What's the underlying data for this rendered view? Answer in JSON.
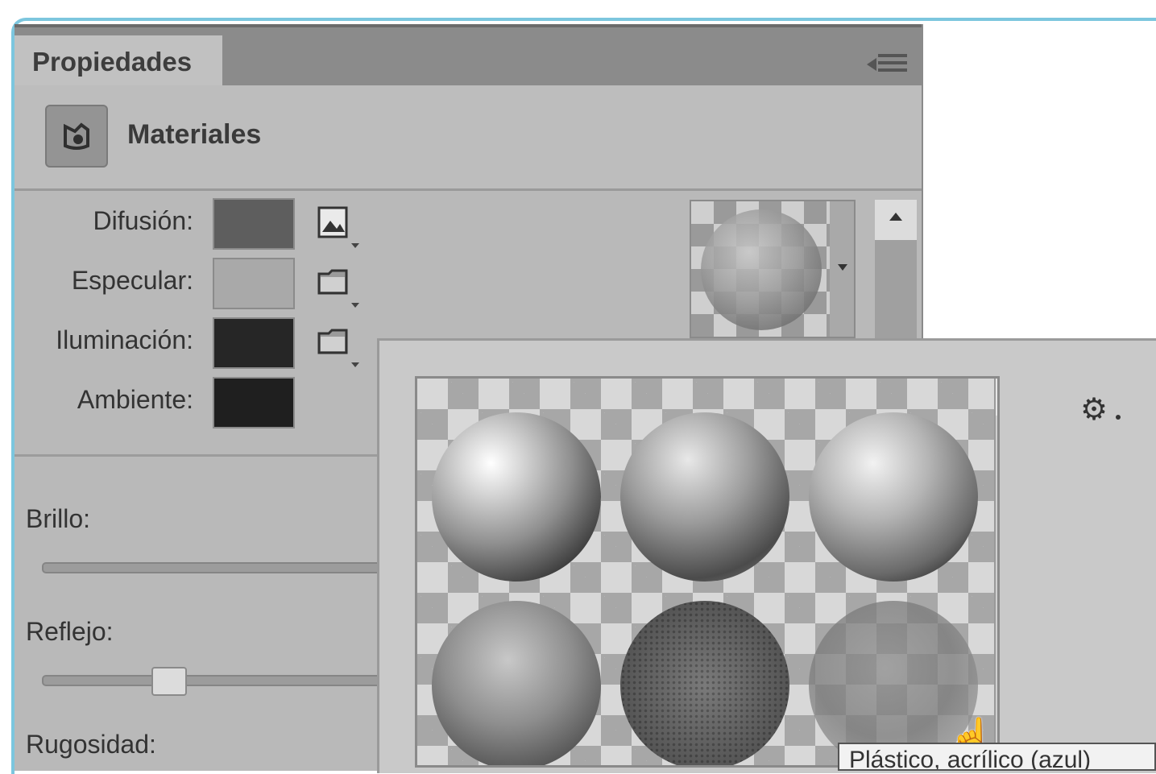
{
  "panel": {
    "tab_label": "Propiedades",
    "section_title": "Materiales"
  },
  "properties": [
    {
      "label": "Difusión:",
      "color": "#5e5e5e",
      "button_icon": "image-texture-icon"
    },
    {
      "label": "Especular:",
      "color": "#a9a9a9",
      "button_icon": "folder-icon"
    },
    {
      "label": "Iluminación:",
      "color": "#262626",
      "button_icon": "folder-icon"
    },
    {
      "label": "Ambiente:",
      "color": "#1f1f1f"
    }
  ],
  "sliders": [
    {
      "label": "Brillo:"
    },
    {
      "label": "Reflejo:"
    },
    {
      "label": "Rugosidad:"
    }
  ],
  "material_picker": {
    "icon": "gear-icon",
    "tooltip": "Plástico, acrílico (azul)"
  }
}
